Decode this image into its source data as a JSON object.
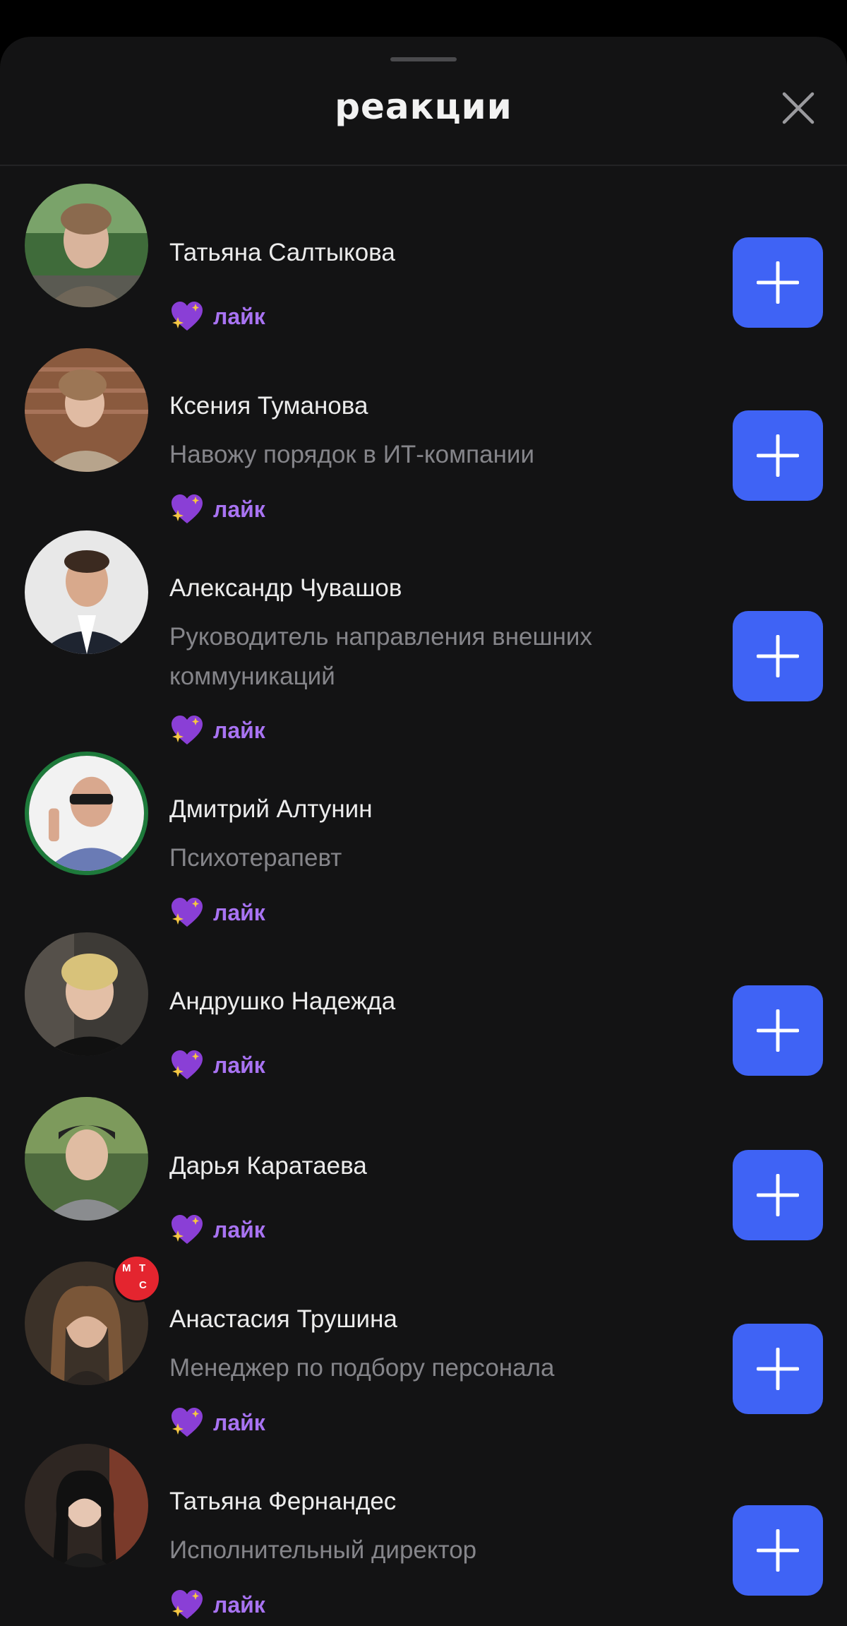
{
  "sheet": {
    "title": "реакции"
  },
  "colors": {
    "accent_button": "#3f63f5",
    "reaction_text": "#a873f2",
    "badge": "#e4252f"
  },
  "badge_text": [
    "М",
    "Т",
    "С"
  ],
  "reactions": [
    {
      "name": "Татьяна Салтыкова",
      "role": "",
      "reaction": "лайк",
      "avatar_icon": "user-photo",
      "follow_button": true
    },
    {
      "name": "Ксения Туманова",
      "role": "Навожу порядок в ИТ-компании",
      "reaction": "лайк",
      "avatar_icon": "user-photo",
      "follow_button": true
    },
    {
      "name": "Александр Чувашов",
      "role": "Руководитель направления внешних коммуникаций",
      "reaction": "лайк",
      "avatar_icon": "user-photo",
      "follow_button": true
    },
    {
      "name": "Дмитрий Алтунин",
      "role": "Психотерапевт",
      "reaction": "лайк",
      "avatar_icon": "user-photo",
      "follow_button": false
    },
    {
      "name": "Андрушко Надежда",
      "role": "",
      "reaction": "лайк",
      "avatar_icon": "user-photo",
      "follow_button": true
    },
    {
      "name": "Дарья Каратаева",
      "role": "",
      "reaction": "лайк",
      "avatar_icon": "user-photo",
      "follow_button": true
    },
    {
      "name": "Анастасия Трушина",
      "role": "Менеджер по подбору персонала",
      "reaction": "лайк",
      "avatar_icon": "user-photo",
      "follow_button": true
    },
    {
      "name": "Татьяна Фернандес",
      "role": "Исполнительный директор",
      "reaction": "лайк",
      "avatar_icon": "user-photo",
      "follow_button": true
    }
  ]
}
